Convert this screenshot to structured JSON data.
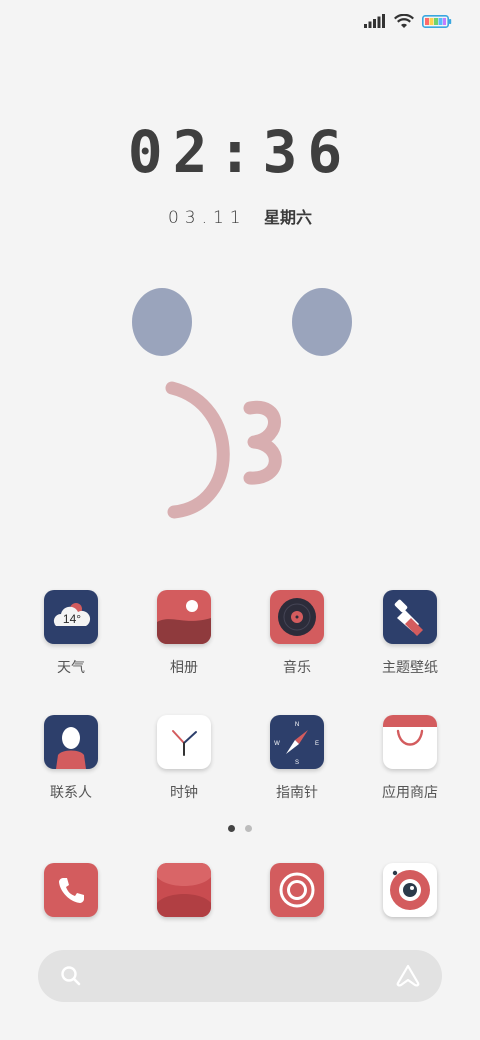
{
  "status": {
    "signal_icon": "cellular-signal-icon",
    "wifi_icon": "wifi-icon",
    "battery_icon": "battery-icon"
  },
  "lock": {
    "time": "02:36",
    "date": "03.11",
    "weekday": "星期六"
  },
  "apps_row1": [
    {
      "label": "天气",
      "badge": "14°"
    },
    {
      "label": "相册"
    },
    {
      "label": "音乐"
    },
    {
      "label": "主题壁纸"
    }
  ],
  "apps_row2": [
    {
      "label": "联系人"
    },
    {
      "label": "时钟"
    },
    {
      "label": "指南针"
    },
    {
      "label": "应用商店"
    }
  ],
  "dock": {
    "phone_icon": "phone-icon",
    "messages_icon": "messages-icon",
    "camera_icon": "camera-icon",
    "browser_icon": "browser-icon"
  },
  "search": {
    "search_icon": "search-icon",
    "assistant_icon": "assistant-icon"
  },
  "colors": {
    "navy": "#2d3f6b",
    "coral": "#d35c5e",
    "face_eye": "#9aa4bc",
    "face_mouth": "#d8aeb0"
  }
}
